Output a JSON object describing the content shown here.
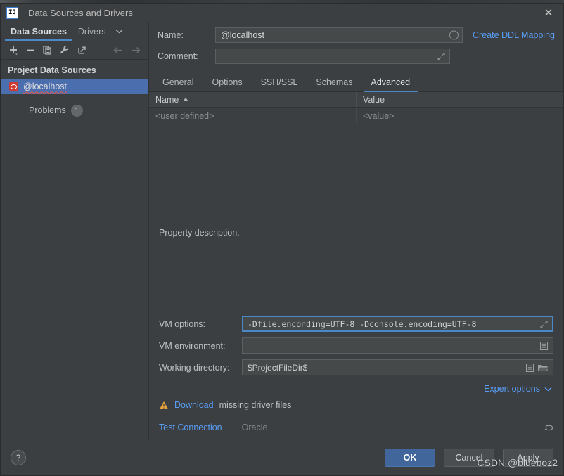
{
  "window": {
    "title": "Data Sources and Drivers",
    "logo_text": "IJ",
    "close_label": "✕"
  },
  "left_panel": {
    "tabs": [
      {
        "label": "Data Sources",
        "active": true
      },
      {
        "label": "Drivers",
        "active": false
      }
    ],
    "tabs_overflow_icon": "chevron-down-icon",
    "toolbar": [
      {
        "name": "add-icon",
        "glyph": "+",
        "enabled": true
      },
      {
        "name": "remove-icon",
        "glyph": "−",
        "enabled": true
      },
      {
        "name": "copy-icon",
        "glyph": "❐",
        "enabled": true
      },
      {
        "name": "wrench-icon",
        "glyph": "🔧",
        "enabled": true
      },
      {
        "name": "share-icon",
        "glyph": "↗",
        "enabled": true
      },
      {
        "name": "back-icon",
        "glyph": "←",
        "enabled": false
      },
      {
        "name": "forward-icon",
        "glyph": "→",
        "enabled": false
      }
    ],
    "section_title": "Project Data Sources",
    "data_sources": [
      {
        "label": "@localhost",
        "icon": "oracle-icon",
        "selected": true
      }
    ],
    "problems": {
      "label": "Problems",
      "count": "1"
    }
  },
  "form": {
    "name_label": "Name:",
    "name_value": "@localhost",
    "name_field_icon": "circle-status-icon",
    "create_ddl_mapping": "Create DDL Mapping",
    "comment_label": "Comment:",
    "comment_value": "",
    "comment_placeholder": "",
    "comment_field_icon": "expand-icon"
  },
  "tabs": [
    {
      "label": "General",
      "active": false
    },
    {
      "label": "Options",
      "active": false
    },
    {
      "label": "SSH/SSL",
      "active": false
    },
    {
      "label": "Schemas",
      "active": false
    },
    {
      "label": "Advanced",
      "active": true
    }
  ],
  "properties_table": {
    "columns": [
      {
        "label": "Name",
        "sorted": true,
        "sort_direction": "asc"
      },
      {
        "label": "Value",
        "sorted": false
      }
    ],
    "rows": [
      {
        "name": "<user defined>",
        "value": "<value>"
      }
    ]
  },
  "advanced": {
    "property_description": "Property description.",
    "vm_options": {
      "label": "VM options:",
      "value": "-Dfile.enconding=UTF-8 -Dconsole.encoding=UTF-8",
      "focused": true,
      "icon": "expand-icon"
    },
    "vm_environment": {
      "label": "VM environment:",
      "value": "",
      "icon": "list-icon"
    },
    "working_directory": {
      "label": "Working directory:",
      "value": "$ProjectFileDir$",
      "icon_1": "folder-icon",
      "icon_2": "list-icon"
    },
    "expert_options": "Expert options"
  },
  "status": {
    "warning_icon": "warning-triangle-icon",
    "download_link": "Download",
    "warning_text": "missing driver files",
    "test_connection": "Test Connection",
    "driver_name": "Oracle",
    "reset_icon": "reset-arrow-icon"
  },
  "footer": {
    "help_label": "?",
    "buttons": [
      {
        "label": "OK",
        "primary": true
      },
      {
        "label": "Cancel",
        "primary": false
      },
      {
        "label": "Apply",
        "primary": false
      }
    ]
  },
  "watermark": "CSDN @blueboz2",
  "colors": {
    "accent": "#4a88c7",
    "link": "#589df6",
    "selection": "#4b6eaf",
    "warning": "#e8a33d",
    "oracle_red": "#cf3a32",
    "window_bg": "#3c3f41",
    "primary_button": "#41669b"
  }
}
